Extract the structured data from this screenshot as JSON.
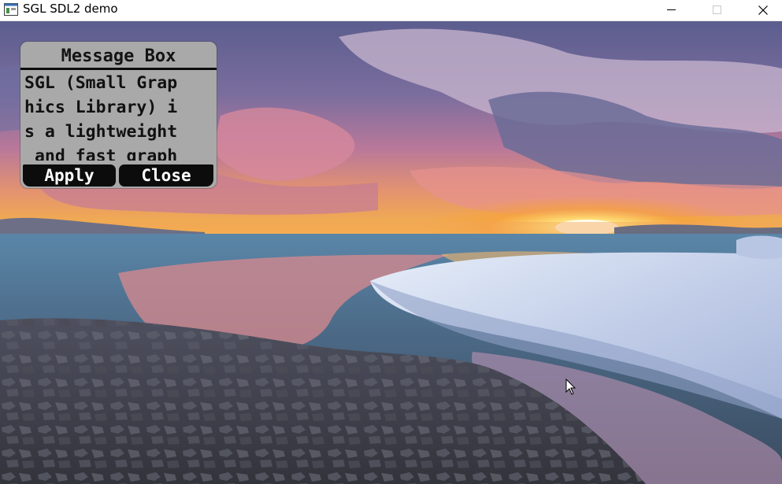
{
  "window": {
    "title": "SGL SDL2 demo",
    "icon": "app-window-icon",
    "controls": [
      "minimize-icon",
      "maximize-icon",
      "close-icon"
    ]
  },
  "scene": {
    "description_icon": "background-image",
    "colors": {
      "sky_top": "#5d5f90",
      "sky_mid": "#9f7aa6",
      "sunset_glow": "#f5b23a",
      "sun": "#fff4b0",
      "water": "#4d6c88",
      "ice": "#c9d6ee",
      "rocks": "#3f3f48"
    }
  },
  "message_box": {
    "title": "Message Box",
    "lines": [
      "SGL (Small Grap",
      "hics Library) i",
      "s a lightweight",
      " and fast graph"
    ],
    "buttons": {
      "apply": "Apply",
      "close": "Close"
    },
    "colors": {
      "panel": "#a9a9a9",
      "button": "#0c0c0c",
      "button_text": "#ffffff"
    }
  },
  "cursor": "mouse-pointer-icon"
}
